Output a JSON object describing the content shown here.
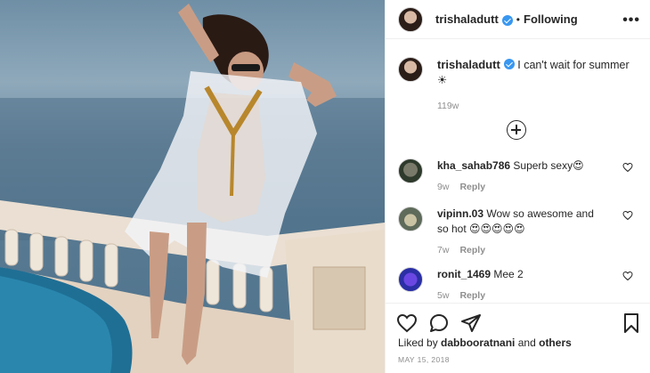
{
  "post": {
    "username": "trishaladutt",
    "follow_separator": "•",
    "follow_status": "Following",
    "more_label": "•••"
  },
  "caption": {
    "username": "trishaladutt",
    "text": "I can't wait for summer ☀",
    "time": "119w"
  },
  "comments": [
    {
      "username": "kha_sahab786",
      "text": "Superb sexy😍",
      "time": "9w",
      "reply": "Reply"
    },
    {
      "username": "vipinn.03",
      "text": "Wow so awesome and so hot 😍😍😍😍😍",
      "time": "7w",
      "reply": "Reply"
    },
    {
      "username": "ronit_1469",
      "text": "Mee 2",
      "time": "5w",
      "reply": "Reply"
    }
  ],
  "footer": {
    "liked_by_prefix": "Liked by",
    "liked_by_user": "dabbooratnani",
    "liked_by_and": "and",
    "liked_by_others": "others",
    "date": "MAY 15, 2018"
  },
  "icons": {
    "verified": "verified-badge-icon",
    "more": "more-options-icon",
    "load_more": "plus-circle-icon",
    "heart": "heart-icon",
    "comment": "comment-bubble-icon",
    "share": "paper-plane-icon",
    "save": "bookmark-icon"
  },
  "colors": {
    "text": "#262626",
    "muted": "#8e8e8e",
    "verified": "#3897f0",
    "border": "#efefef"
  }
}
